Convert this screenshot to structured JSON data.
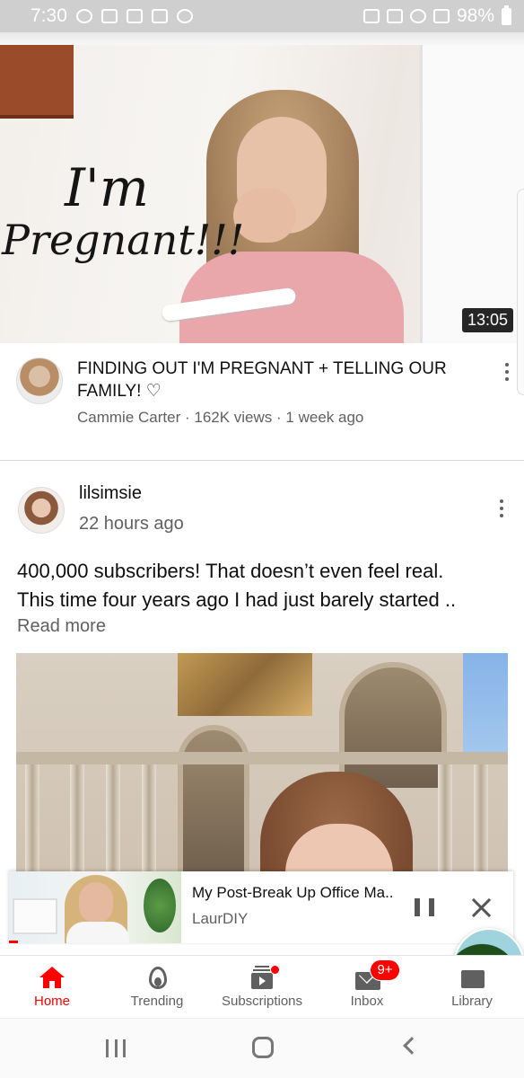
{
  "status_bar": {
    "time": "7:30",
    "battery": "98%",
    "icons": [
      "accessibility-icon",
      "book-icon",
      "gallery-icon",
      "car-icon",
      "messenger-icon",
      "nfc-icon",
      "mute-icon",
      "wifi-icon",
      "signal-icon",
      "battery-icon"
    ]
  },
  "video": {
    "thumbnail_text_line1": "I'm",
    "thumbnail_text_line2": "Pregnant!!!",
    "duration": "13:05",
    "title": "FINDING OUT I'M PREGNANT + TELLING OUR FAMILY! ♡",
    "channel": "Cammie Carter",
    "views": "162K views",
    "age": "1 week ago",
    "separator": " · "
  },
  "post": {
    "author": "lilsimsie",
    "time": "22 hours ago",
    "text_line1": "400,000 subscribers! That doesn’t even feel real.",
    "text_line2": "This time four years ago I had just barely started ..",
    "read_more": "Read more"
  },
  "mini_player": {
    "title": "My Post-Break Up Office Ma..",
    "channel": "LaurDIY",
    "progress": 0.05
  },
  "bottom_nav": {
    "items": [
      {
        "label": "Home",
        "icon": "home-icon",
        "active": true
      },
      {
        "label": "Trending",
        "icon": "trending-icon",
        "active": false
      },
      {
        "label": "Subscriptions",
        "icon": "subscriptions-icon",
        "active": false
      },
      {
        "label": "Inbox",
        "icon": "inbox-icon",
        "active": false,
        "badge": "9+"
      },
      {
        "label": "Library",
        "icon": "library-icon",
        "active": false
      }
    ]
  },
  "colors": {
    "accent": "#ff0000",
    "text_primary": "#0f0f0f",
    "text_secondary": "#606060",
    "status_bar": "#cfcfcf"
  }
}
